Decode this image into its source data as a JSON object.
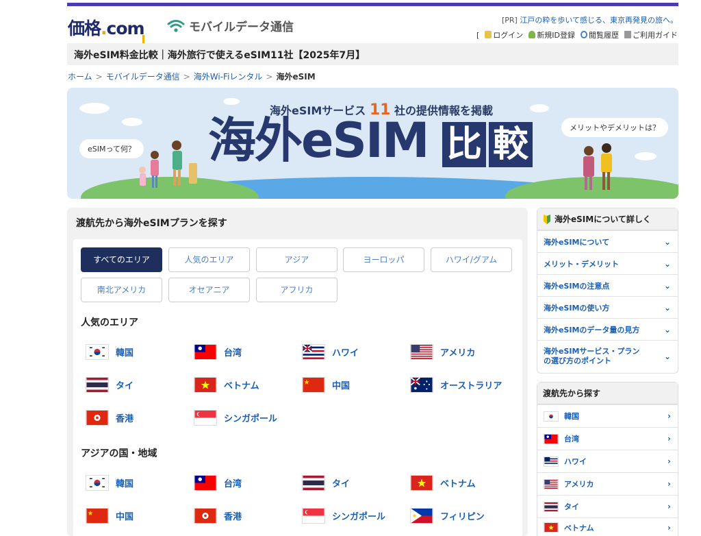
{
  "header": {
    "logo_main": "価格",
    "logo_dot": ".",
    "logo_com": "com",
    "mobile_logo": "モバイルデータ通信",
    "pr_prefix": "[PR]",
    "pr_link": "江戸の粋を歩いて感じる、東京再発見の旅へ。",
    "util_open_bracket": "[",
    "util_login": "ログイン",
    "util_register": "新規ID登録",
    "util_history": "閲覧履歴",
    "util_guide": "ご利用ガイド"
  },
  "page_title": "海外eSIM料金比較｜海外旅行で使えるeSIM11社【2025年7月】",
  "breadcrumb": [
    "ホーム",
    "モバイルデータ通信",
    "海外Wi-Fiレンタル",
    "海外eSIM"
  ],
  "banner": {
    "sub_prefix": "海外eSIMサービス",
    "sub_num": "11",
    "sub_suffix": "社の提供情報を掲載",
    "big": "海外eSIM",
    "box1": "比",
    "box2": "較",
    "bubble_left": "eSIMって何？",
    "bubble_right": "メリットやデメリットは？"
  },
  "main": {
    "heading": "渡航先から海外eSIMプランを探す",
    "tabs": [
      "すべてのエリア",
      "人気のエリア",
      "アジア",
      "ヨーロッパ",
      "ハワイ/グアム",
      "南北アメリカ",
      "オセアニア",
      "アフリカ"
    ],
    "active_tab": "すべてのエリア",
    "popular_title": "人気のエリア",
    "popular": [
      "韓国",
      "台湾",
      "ハワイ",
      "アメリカ",
      "タイ",
      "ベトナム",
      "中国",
      "オーストラリア",
      "香港",
      "シンガポール"
    ],
    "asia_title": "アジアの国・地域",
    "asia": [
      "韓国",
      "台湾",
      "タイ",
      "ベトナム",
      "中国",
      "香港",
      "シンガポール",
      "フィリピン"
    ]
  },
  "sidebar": {
    "about_heading": "海外eSIMについて詳しく",
    "about_items": [
      "海外eSIMについて",
      "メリット・デメリット",
      "海外eSIMの注意点",
      "海外eSIMの使い方",
      "海外eSIMのデータ量の見方",
      "海外eSIMサービス・プラン\nの選び方のポイント"
    ],
    "dest_heading": "渡航先から探す",
    "dest_items": [
      "韓国",
      "台湾",
      "ハワイ",
      "アメリカ",
      "タイ",
      "ベトナム"
    ]
  },
  "colors": {
    "brand_navy": "#1e2f5e",
    "accent_purple": "#4a3bb5",
    "link_blue": "#1a5fb4",
    "accent_orange": "#e2682a"
  }
}
